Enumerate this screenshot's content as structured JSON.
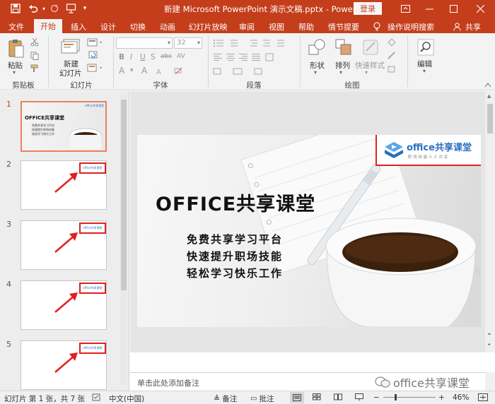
{
  "titlebar": {
    "title": "新建 Microsoft PowerPoint 演示文稿.pptx  -  PowerPoint",
    "login_label": "登录",
    "qat_icons": [
      "save-icon",
      "undo-icon",
      "redo-icon",
      "present-icon",
      "customize-icon"
    ]
  },
  "tabs": [
    {
      "label": "文件"
    },
    {
      "label": "开始"
    },
    {
      "label": "插入"
    },
    {
      "label": "设计"
    },
    {
      "label": "切换"
    },
    {
      "label": "动画"
    },
    {
      "label": "幻灯片放映"
    },
    {
      "label": "审阅"
    },
    {
      "label": "视图"
    },
    {
      "label": "帮助"
    },
    {
      "label": "情节提要"
    }
  ],
  "tell_me": "操作说明搜索",
  "share": "共享",
  "ribbon": {
    "paste_label": "粘贴",
    "new_slide_label_1": "新建",
    "new_slide_label_2": "幻灯片",
    "font_size": "32",
    "shape_label": "形状",
    "arrange_label": "排列",
    "quick_styles_label": "快速样式",
    "edit_label": "编辑",
    "groups": {
      "clipboard": "剪贴板",
      "slides": "幻灯片",
      "font": "字体",
      "paragraph": "段落",
      "drawing": "绘图"
    },
    "font_buttons": [
      "B",
      "I",
      "U",
      "S",
      "abc",
      "AV"
    ],
    "font_buttons2": [
      "A",
      "A"
    ]
  },
  "thumbnails": [
    {
      "num": "1",
      "title": "OFFICE共享课堂",
      "lines": [
        "免费共享学习平台",
        "快速提升职场技能",
        "轻松学习快乐工作"
      ]
    },
    {
      "num": "2"
    },
    {
      "num": "3"
    },
    {
      "num": "4"
    },
    {
      "num": "5"
    }
  ],
  "slide": {
    "logo_text": "office共享课堂",
    "logo_sub": "职 场 技 能 人 人 共 享",
    "title": "OFFICE共享课堂",
    "lines": [
      "免费共享学习平台",
      "快速提升职场技能",
      "轻松学习快乐工作"
    ]
  },
  "notes_placeholder": "单击此处添加备注",
  "statusbar": {
    "slide_info": "幻灯片 第 1 张，共 7 张",
    "language": "中文(中国)",
    "notes": "备注",
    "comments": "批注",
    "zoom": "46%"
  },
  "watermark": "office共享课堂",
  "colors": {
    "brand": "#c43e1c",
    "annotation": "#e02020"
  }
}
